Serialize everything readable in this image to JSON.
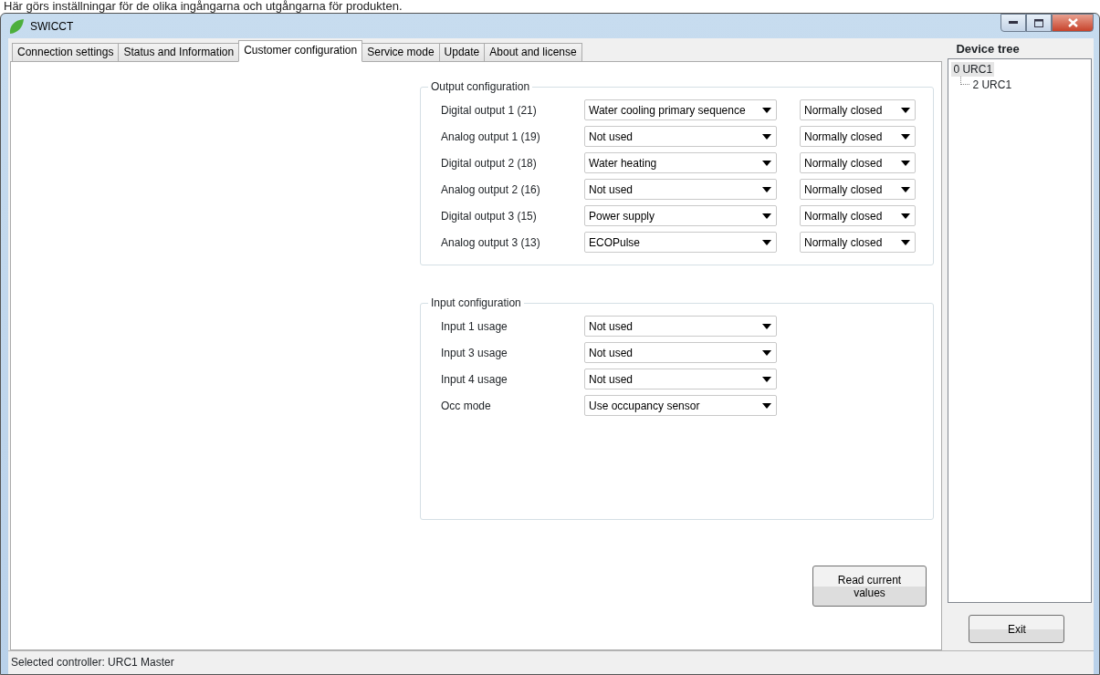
{
  "caption": "Här görs inställningar för de olika ingångarna och utgångarna för produkten.",
  "window": {
    "title": "SWICCT"
  },
  "tabs": [
    {
      "label": "Connection settings",
      "selected": false
    },
    {
      "label": "Status and Information",
      "selected": false
    },
    {
      "label": "Customer configuration",
      "selected": true
    },
    {
      "label": "Service mode",
      "selected": false
    },
    {
      "label": "Update",
      "selected": false
    },
    {
      "label": "About and license",
      "selected": false
    }
  ],
  "output_configuration": {
    "title": "Output configuration",
    "rows": [
      {
        "label": "Digital output 1 (21)",
        "function": "Water cooling primary sequence",
        "polarity": "Normally closed"
      },
      {
        "label": "Analog output 1 (19)",
        "function": "Not used",
        "polarity": "Normally closed"
      },
      {
        "label": "Digital output 2 (18)",
        "function": "Water heating",
        "polarity": "Normally closed"
      },
      {
        "label": "Analog output 2 (16)",
        "function": "Not used",
        "polarity": "Normally closed"
      },
      {
        "label": "Digital output 3 (15)",
        "function": "Power supply",
        "polarity": "Normally closed"
      },
      {
        "label": "Analog output 3 (13)",
        "function": "ECOPulse",
        "polarity": "Normally closed"
      }
    ]
  },
  "input_configuration": {
    "title": "Input configuration",
    "rows": [
      {
        "label": "Input 1 usage",
        "value": "Not used"
      },
      {
        "label": "Input 3 usage",
        "value": "Not used"
      },
      {
        "label": "Input 4 usage",
        "value": "Not used"
      },
      {
        "label": "Occ mode",
        "value": "Use occupancy sensor"
      }
    ]
  },
  "read_button": "Read current values",
  "device_tree": {
    "title": "Device tree",
    "nodes": [
      {
        "label": "0 URC1",
        "selected": true,
        "children": [
          {
            "label": "2 URC1",
            "selected": false
          }
        ]
      }
    ]
  },
  "exit_button": "Exit",
  "status_bar": "Selected controller: URC1 Master"
}
